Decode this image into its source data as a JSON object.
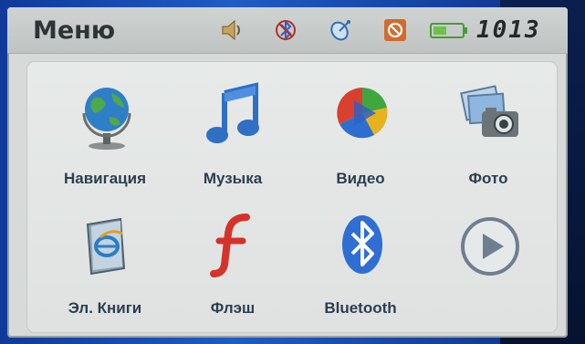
{
  "header": {
    "title": "Меню",
    "clock": "1013"
  },
  "status_icons": [
    "volume-icon",
    "bluetooth-disabled-icon",
    "satellite-icon",
    "blocked-icon",
    "battery-icon"
  ],
  "apps": [
    {
      "label": "Навигация",
      "icon": "globe-icon"
    },
    {
      "label": "Музыка",
      "icon": "music-note-icon"
    },
    {
      "label": "Видео",
      "icon": "video-icon"
    },
    {
      "label": "Фото",
      "icon": "photo-camera-icon"
    },
    {
      "label": "Эл. Книги",
      "icon": "ebook-icon"
    },
    {
      "label": "Флэш",
      "icon": "flash-icon"
    },
    {
      "label": "Bluetooth",
      "icon": "bluetooth-icon"
    },
    {
      "label": "",
      "icon": "next-page-arrow-icon"
    }
  ],
  "colors": {
    "accent": "#2c3e50",
    "screen_bg": "#d7dad8",
    "bezel": "#1a4fae"
  }
}
